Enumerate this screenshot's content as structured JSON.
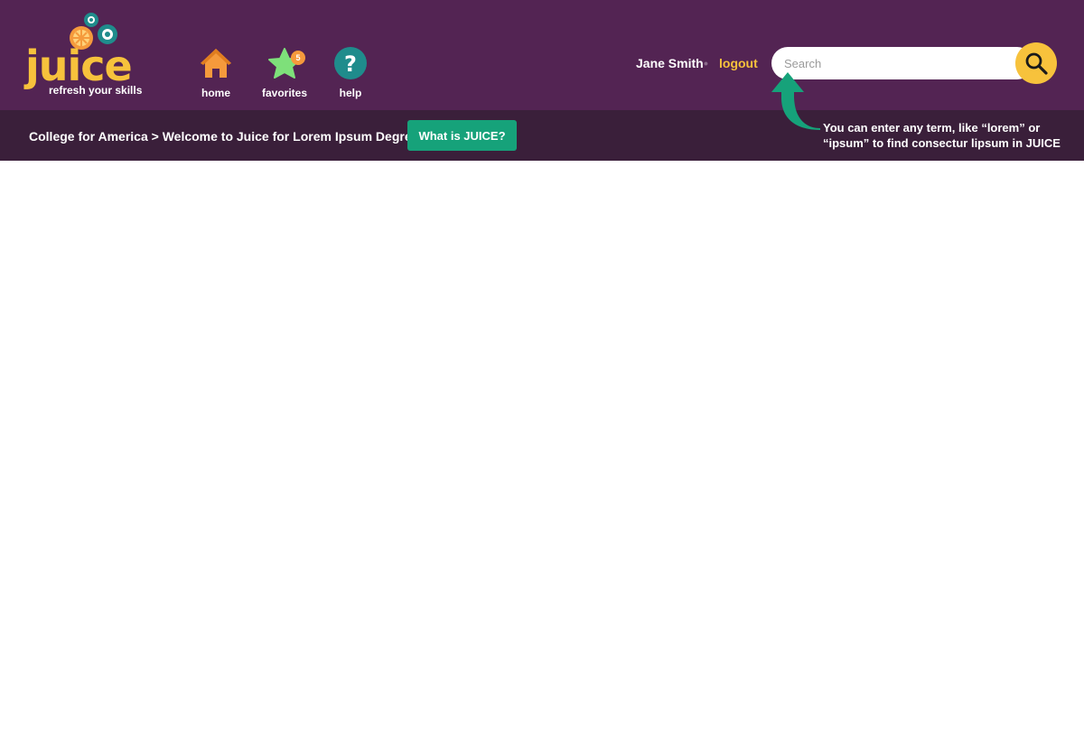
{
  "logo": {
    "word": "juice",
    "tagline": "refresh your skills"
  },
  "nav": [
    {
      "label": "home",
      "icon": "home-icon"
    },
    {
      "label": "favorites",
      "icon": "star-icon",
      "badge": "5"
    },
    {
      "label": "help",
      "icon": "help-icon"
    }
  ],
  "user": {
    "name": "Jane Smith",
    "separator": "•",
    "logout": "logout"
  },
  "search": {
    "placeholder": "Search",
    "value": "",
    "button_icon": "search-icon"
  },
  "breadcrumb": {
    "text": "College for America > Welcome to Juice for Lorem Ipsum Degree!"
  },
  "what_button": {
    "label": "What is JUICE?"
  },
  "tip": {
    "text": "You can enter any term, like “lorem” or “ipsum” to find consectur lipsum in JUICE"
  },
  "colors": {
    "header_bg": "#532453",
    "subbar_bg": "#3a1f3a",
    "brand_yellow": "#f7c23c",
    "brand_orange": "#f59a3c",
    "teal": "#1f8c8c",
    "green": "#16a27a",
    "star_green": "#7ee07a"
  }
}
